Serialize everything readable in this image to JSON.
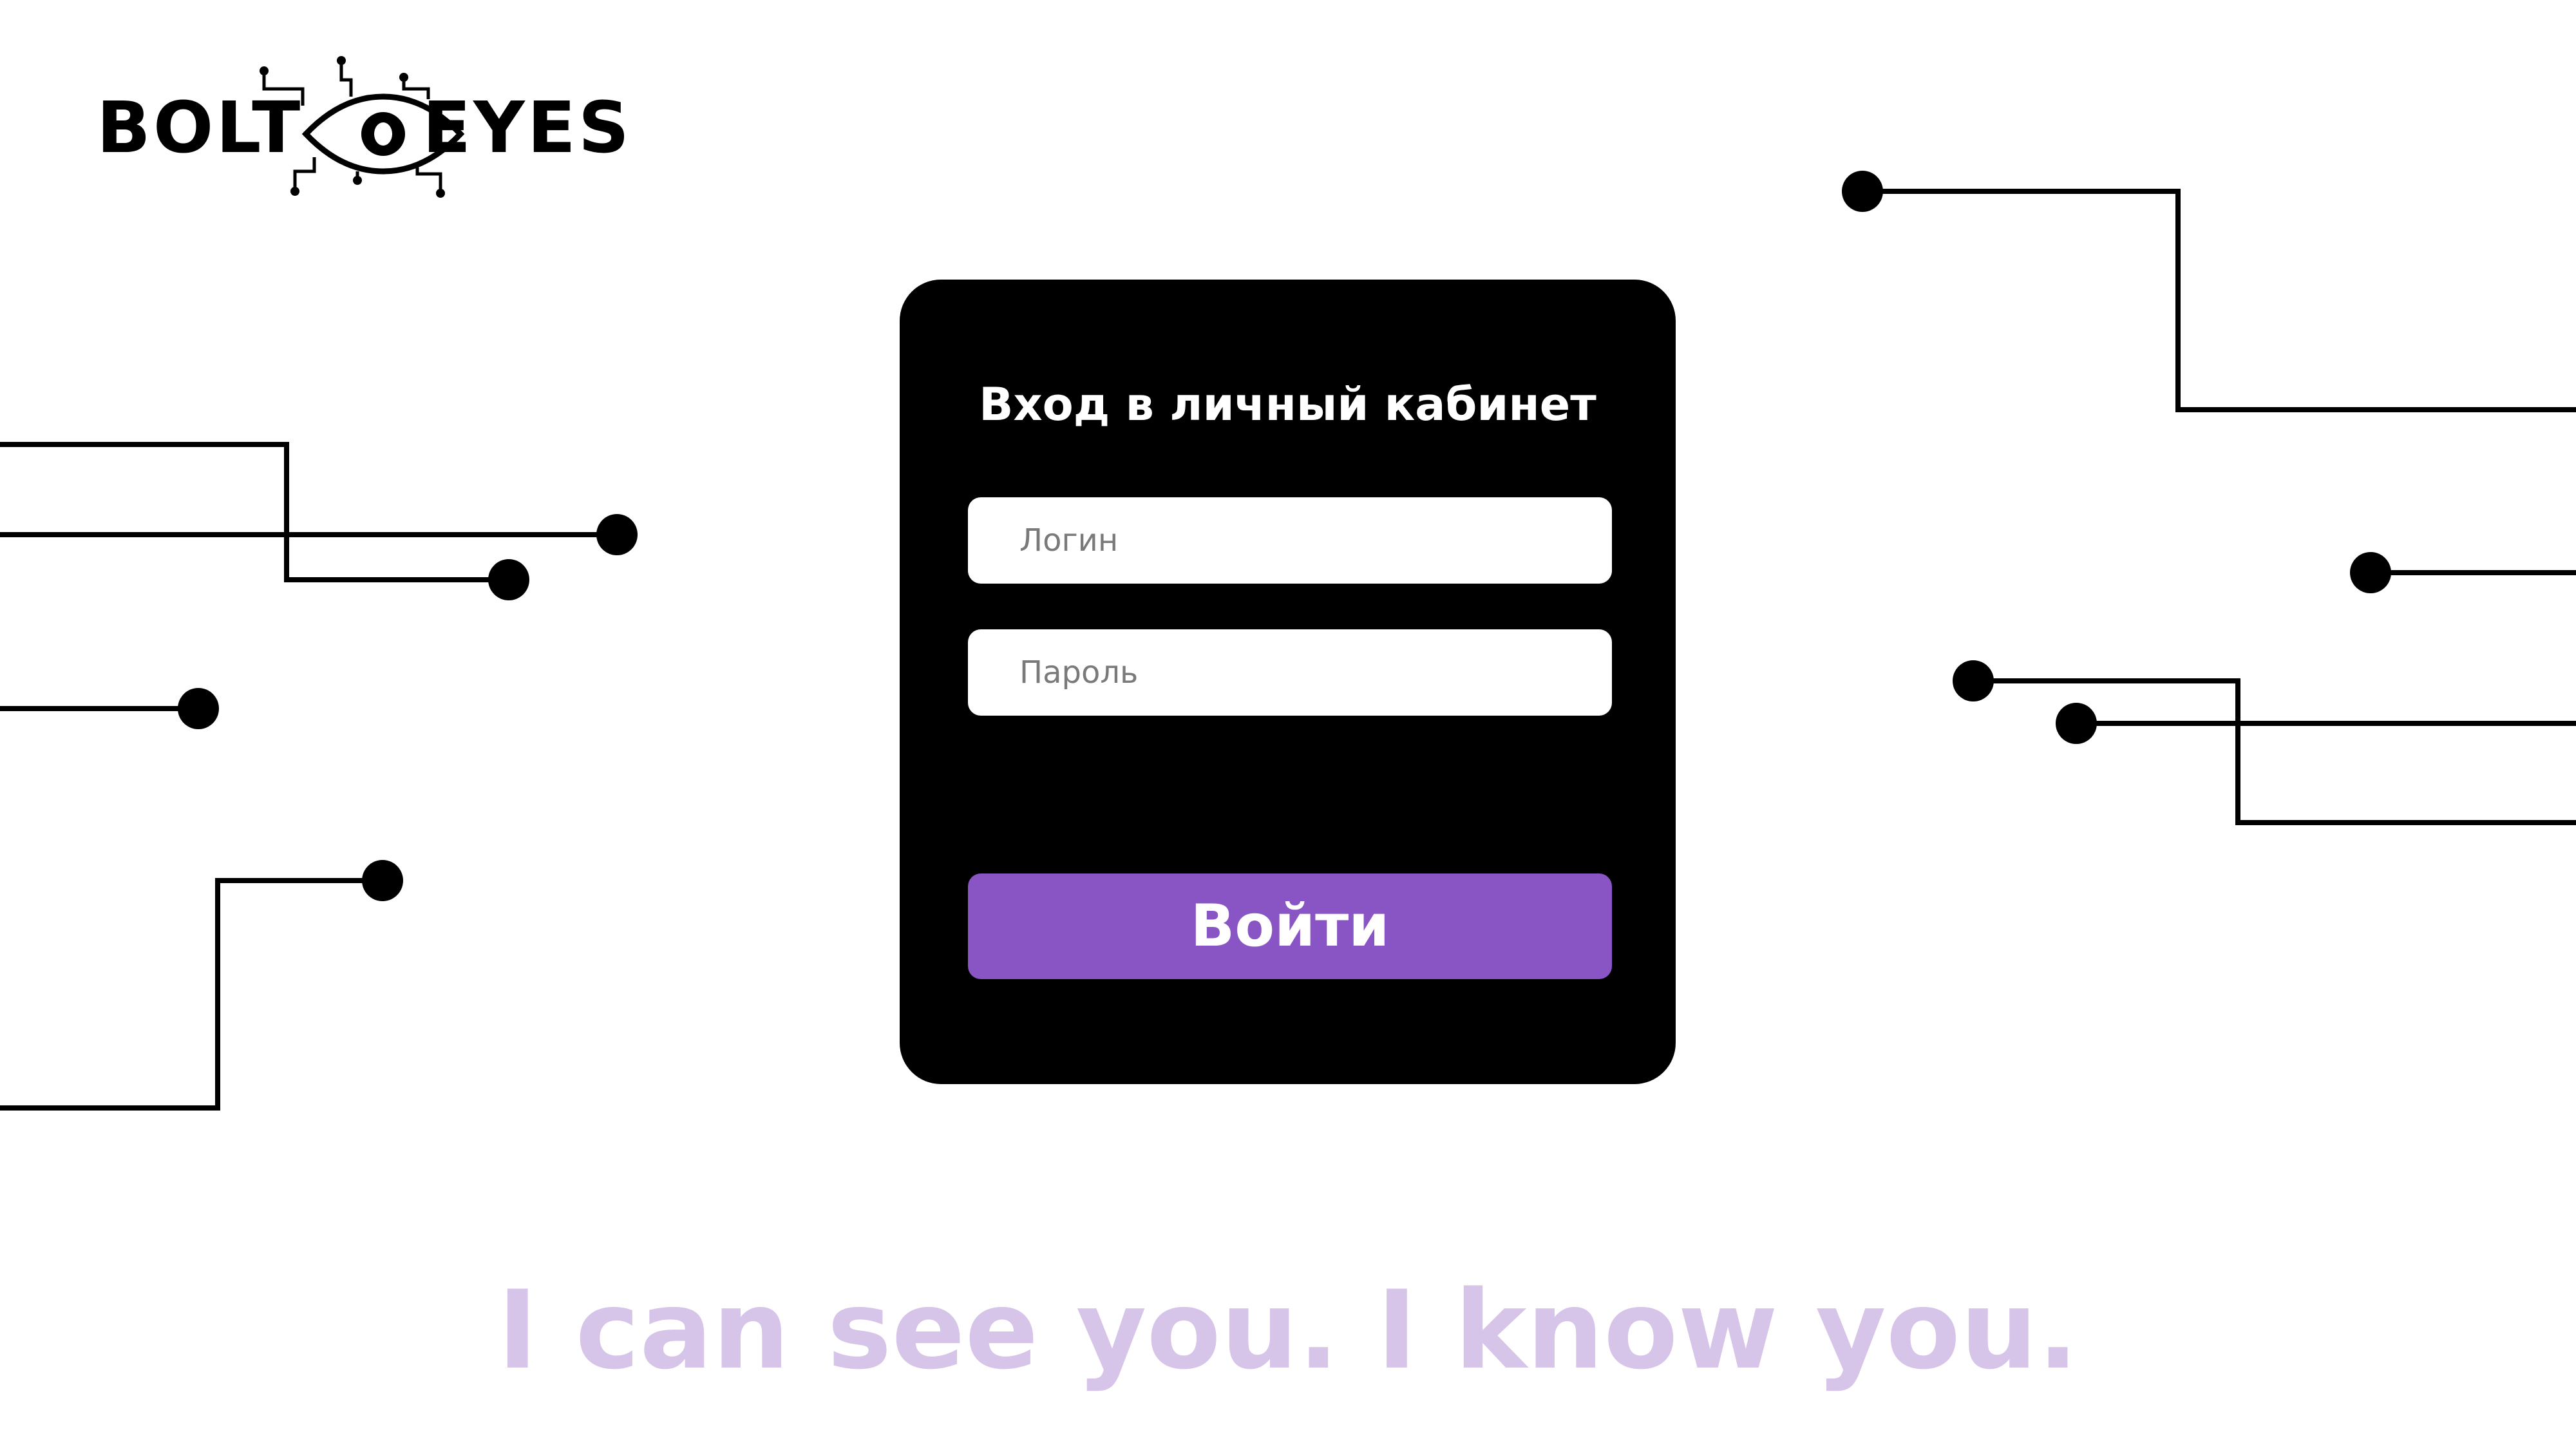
{
  "brand": {
    "word_left": "BOLT",
    "word_right": "EYES",
    "mark_icon": "circuit-eye-icon"
  },
  "login_card": {
    "title": "Вход в личный кабинет",
    "login_placeholder": "Логин",
    "password_placeholder": "Пароль",
    "submit_label": "Войти"
  },
  "tagline": "I can see you. I know you.",
  "colors": {
    "background": "#ffffff",
    "card": "#000000",
    "accent": "#8955c4",
    "tagline": "#d6c4e9",
    "circuit": "#000000"
  }
}
